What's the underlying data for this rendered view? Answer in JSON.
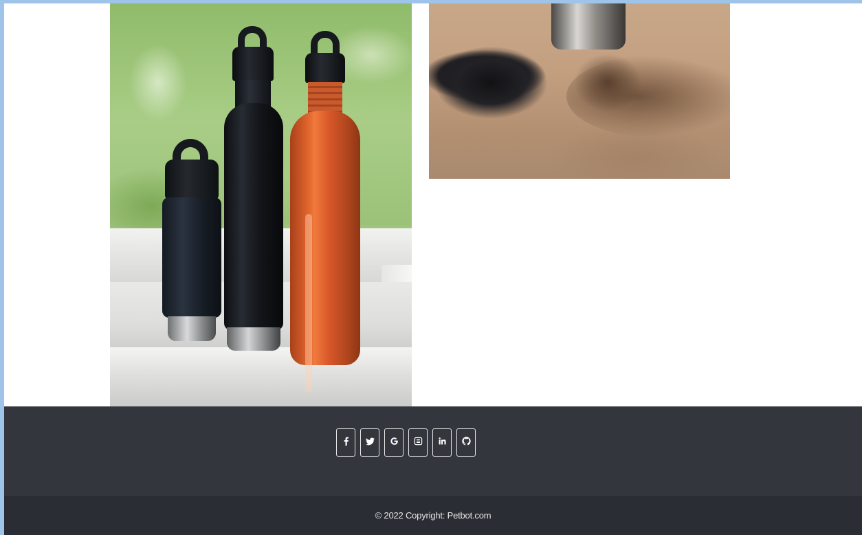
{
  "gallery": {
    "images": [
      {
        "name": "stainless-water-bottles"
      },
      {
        "name": "canister-in-sand"
      }
    ]
  },
  "footer": {
    "social": [
      {
        "icon": "facebook-icon",
        "glyph": "f"
      },
      {
        "icon": "twitter-icon",
        "glyph": "twitter"
      },
      {
        "icon": "google-icon",
        "glyph": "G"
      },
      {
        "icon": "instagram-icon",
        "glyph": "instagram"
      },
      {
        "icon": "linkedin-icon",
        "glyph": "in"
      },
      {
        "icon": "github-icon",
        "glyph": "github"
      }
    ],
    "copyright": "© 2022 Copyright: Petbot.com"
  },
  "colors": {
    "background_frame": "#9fc4ea",
    "footer_top": "#33373d",
    "footer_bottom": "#2a2d33",
    "icon_border": "#e8e8e8"
  }
}
